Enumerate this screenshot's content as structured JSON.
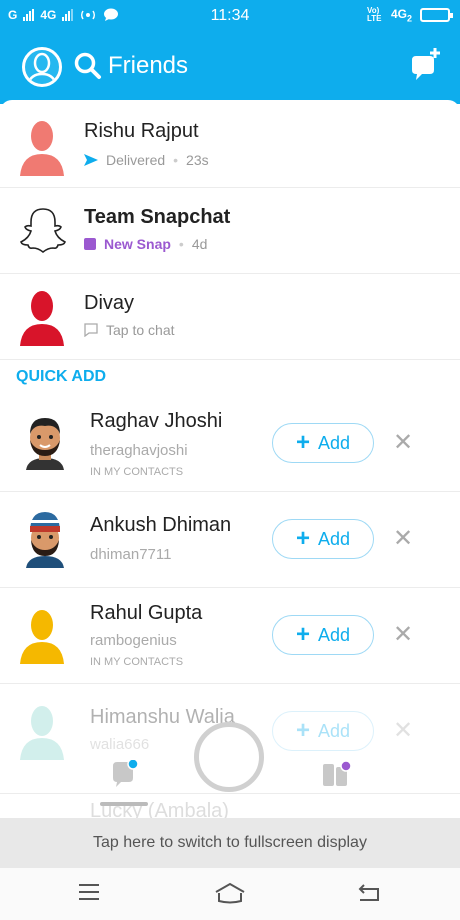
{
  "status": {
    "carrier1": "G",
    "carrier2": "4G",
    "time": "11:34",
    "volte": "Vo) LTE",
    "net": "4G",
    "net_sub": "2"
  },
  "header": {
    "title": "Friends"
  },
  "friends": [
    {
      "name": "Rishu Rajput",
      "status": "Delivered",
      "time": "23s",
      "avatar_color": "#f07a72"
    },
    {
      "name": "Team Snapchat",
      "status": "New Snap",
      "time": "4d"
    },
    {
      "name": "Divay",
      "status": "Tap to chat",
      "avatar_color": "#d8142a"
    }
  ],
  "quick_add": {
    "label": "QUICK ADD",
    "add_label": "Add",
    "people": [
      {
        "name": "Raghav Jhoshi",
        "username": "theraghavjoshi",
        "note": "IN MY CONTACTS"
      },
      {
        "name": "Ankush Dhiman",
        "username": "dhiman7711",
        "note": ""
      },
      {
        "name": "Rahul Gupta",
        "username": "rambogenius",
        "note": "IN MY CONTACTS"
      },
      {
        "name": "Himanshu Walia",
        "username": "walia666",
        "note": ""
      }
    ],
    "partial_name": "Lucky (Ambala)"
  },
  "fullscreen_prompt": "Tap here to switch to fullscreen display",
  "colors": {
    "accent": "#0eaded",
    "new_snap": "#9b59d0",
    "yellow_avatar": "#f5b800"
  }
}
